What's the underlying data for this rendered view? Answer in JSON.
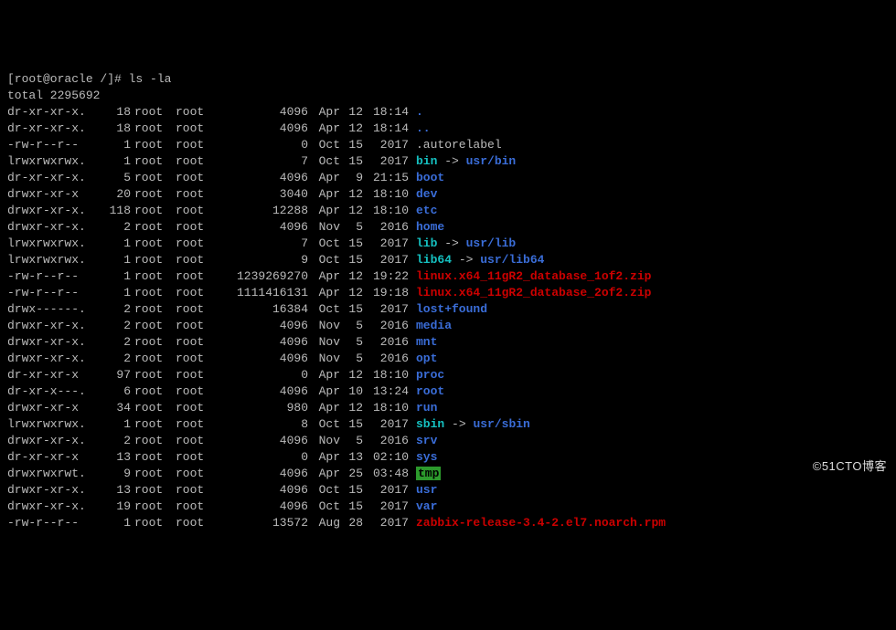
{
  "prompt": "[root@oracle /]# ",
  "command": "ls -la",
  "total_line": "total 2295692",
  "symlink_arrow": " -> ",
  "watermark": "©51CTO博客",
  "rows": [
    {
      "perm": "dr-xr-xr-x.",
      "links": "18",
      "owner": "root",
      "group": "root",
      "size": "4096",
      "month": "Apr",
      "day": "12",
      "time": "18:14",
      "name": ".",
      "color": "blue"
    },
    {
      "perm": "dr-xr-xr-x.",
      "links": "18",
      "owner": "root",
      "group": "root",
      "size": "4096",
      "month": "Apr",
      "day": "12",
      "time": "18:14",
      "name": "..",
      "color": "blue"
    },
    {
      "perm": "-rw-r--r--",
      "links": "1",
      "owner": "root",
      "group": "root",
      "size": "0",
      "month": "Oct",
      "day": "15",
      "time": "2017",
      "name": ".autorelabel",
      "color": ""
    },
    {
      "perm": "lrwxrwxrwx.",
      "links": "1",
      "owner": "root",
      "group": "root",
      "size": "7",
      "month": "Oct",
      "day": "15",
      "time": "2017",
      "name": "bin",
      "color": "cyan",
      "target": "usr/bin",
      "tcolor": "blue"
    },
    {
      "perm": "dr-xr-xr-x.",
      "links": "5",
      "owner": "root",
      "group": "root",
      "size": "4096",
      "month": "Apr",
      "day": "9",
      "time": "21:15",
      "name": "boot",
      "color": "blue"
    },
    {
      "perm": "drwxr-xr-x",
      "links": "20",
      "owner": "root",
      "group": "root",
      "size": "3040",
      "month": "Apr",
      "day": "12",
      "time": "18:10",
      "name": "dev",
      "color": "blue"
    },
    {
      "perm": "drwxr-xr-x.",
      "links": "118",
      "owner": "root",
      "group": "root",
      "size": "12288",
      "month": "Apr",
      "day": "12",
      "time": "18:10",
      "name": "etc",
      "color": "blue"
    },
    {
      "perm": "drwxr-xr-x.",
      "links": "2",
      "owner": "root",
      "group": "root",
      "size": "4096",
      "month": "Nov",
      "day": "5",
      "time": "2016",
      "name": "home",
      "color": "blue"
    },
    {
      "perm": "lrwxrwxrwx.",
      "links": "1",
      "owner": "root",
      "group": "root",
      "size": "7",
      "month": "Oct",
      "day": "15",
      "time": "2017",
      "name": "lib",
      "color": "cyan",
      "target": "usr/lib",
      "tcolor": "blue"
    },
    {
      "perm": "lrwxrwxrwx.",
      "links": "1",
      "owner": "root",
      "group": "root",
      "size": "9",
      "month": "Oct",
      "day": "15",
      "time": "2017",
      "name": "lib64",
      "color": "cyan",
      "target": "usr/lib64",
      "tcolor": "blue"
    },
    {
      "perm": "-rw-r--r--",
      "links": "1",
      "owner": "root",
      "group": "root",
      "size": "1239269270",
      "month": "Apr",
      "day": "12",
      "time": "19:22",
      "name": "linux.x64_11gR2_database_1of2.zip",
      "color": "red"
    },
    {
      "perm": "-rw-r--r--",
      "links": "1",
      "owner": "root",
      "group": "root",
      "size": "1111416131",
      "month": "Apr",
      "day": "12",
      "time": "19:18",
      "name": "linux.x64_11gR2_database_2of2.zip",
      "color": "red"
    },
    {
      "perm": "drwx------.",
      "links": "2",
      "owner": "root",
      "group": "root",
      "size": "16384",
      "month": "Oct",
      "day": "15",
      "time": "2017",
      "name": "lost+found",
      "color": "blue"
    },
    {
      "perm": "drwxr-xr-x.",
      "links": "2",
      "owner": "root",
      "group": "root",
      "size": "4096",
      "month": "Nov",
      "day": "5",
      "time": "2016",
      "name": "media",
      "color": "blue"
    },
    {
      "perm": "drwxr-xr-x.",
      "links": "2",
      "owner": "root",
      "group": "root",
      "size": "4096",
      "month": "Nov",
      "day": "5",
      "time": "2016",
      "name": "mnt",
      "color": "blue"
    },
    {
      "perm": "drwxr-xr-x.",
      "links": "2",
      "owner": "root",
      "group": "root",
      "size": "4096",
      "month": "Nov",
      "day": "5",
      "time": "2016",
      "name": "opt",
      "color": "blue"
    },
    {
      "perm": "dr-xr-xr-x",
      "links": "97",
      "owner": "root",
      "group": "root",
      "size": "0",
      "month": "Apr",
      "day": "12",
      "time": "18:10",
      "name": "proc",
      "color": "blue"
    },
    {
      "perm": "dr-xr-x---.",
      "links": "6",
      "owner": "root",
      "group": "root",
      "size": "4096",
      "month": "Apr",
      "day": "10",
      "time": "13:24",
      "name": "root",
      "color": "blue"
    },
    {
      "perm": "drwxr-xr-x",
      "links": "34",
      "owner": "root",
      "group": "root",
      "size": "980",
      "month": "Apr",
      "day": "12",
      "time": "18:10",
      "name": "run",
      "color": "blue"
    },
    {
      "perm": "lrwxrwxrwx.",
      "links": "1",
      "owner": "root",
      "group": "root",
      "size": "8",
      "month": "Oct",
      "day": "15",
      "time": "2017",
      "name": "sbin",
      "color": "cyan",
      "target": "usr/sbin",
      "tcolor": "blue"
    },
    {
      "perm": "drwxr-xr-x.",
      "links": "2",
      "owner": "root",
      "group": "root",
      "size": "4096",
      "month": "Nov",
      "day": "5",
      "time": "2016",
      "name": "srv",
      "color": "blue"
    },
    {
      "perm": "dr-xr-xr-x",
      "links": "13",
      "owner": "root",
      "group": "root",
      "size": "0",
      "month": "Apr",
      "day": "13",
      "time": "02:10",
      "name": "sys",
      "color": "blue"
    },
    {
      "perm": "drwxrwxrwt.",
      "links": "9",
      "owner": "root",
      "group": "root",
      "size": "4096",
      "month": "Apr",
      "day": "25",
      "time": "03:48",
      "name": "tmp",
      "color": "greenbox"
    },
    {
      "perm": "drwxr-xr-x.",
      "links": "13",
      "owner": "root",
      "group": "root",
      "size": "4096",
      "month": "Oct",
      "day": "15",
      "time": "2017",
      "name": "usr",
      "color": "blue"
    },
    {
      "perm": "drwxr-xr-x.",
      "links": "19",
      "owner": "root",
      "group": "root",
      "size": "4096",
      "month": "Oct",
      "day": "15",
      "time": "2017",
      "name": "var",
      "color": "blue"
    },
    {
      "perm": "-rw-r--r--",
      "links": "1",
      "owner": "root",
      "group": "root",
      "size": "13572",
      "month": "Aug",
      "day": "28",
      "time": "2017",
      "name": "zabbix-release-3.4-2.el7.noarch.rpm",
      "color": "red"
    }
  ]
}
